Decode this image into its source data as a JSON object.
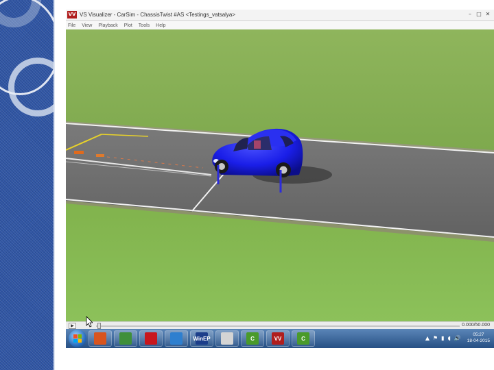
{
  "window": {
    "logo_text": "VV",
    "title": "VS Visualizer - CarSim - ChassisTwist #AS <Testings_vatsalya>",
    "controls": [
      "–",
      "□",
      "✕"
    ]
  },
  "menu": [
    "File",
    "View",
    "Playback",
    "Plot",
    "Tools",
    "Help"
  ],
  "scene": {
    "vehicle_color": "#1a1ee8",
    "grass_color": "#7fae4c",
    "road_color": "#6e6e6e",
    "marker_color": "#e06a1c"
  },
  "playback": {
    "play_symbol": "▶",
    "time": "0.000/50.000",
    "progress": 0.0
  },
  "taskbar": {
    "apps": [
      {
        "name": "matlab",
        "label": "",
        "color": "#d8541e"
      },
      {
        "name": "explorer",
        "label": "",
        "color": "#3f8f3a"
      },
      {
        "name": "acrobat",
        "label": "",
        "color": "#c8161d"
      },
      {
        "name": "network-globe",
        "label": "",
        "color": "#2e7fcf"
      },
      {
        "name": "winep",
        "label": "WinEP",
        "color": "#1c3e8a"
      },
      {
        "name": "paint",
        "label": "",
        "color": "#d4d4d4"
      },
      {
        "name": "camtasia-green",
        "label": "C",
        "color": "#4a9a2a"
      },
      {
        "name": "vs-visualizer",
        "label": "VV",
        "color": "#b01e1e"
      },
      {
        "name": "camtasia-active",
        "label": "C",
        "color": "#4a9a2a"
      }
    ],
    "tray": [
      "▲",
      "⚑",
      "▮",
      "◖",
      "🔊"
    ],
    "clock_time": "05:27",
    "clock_date": "18-04-2015"
  }
}
